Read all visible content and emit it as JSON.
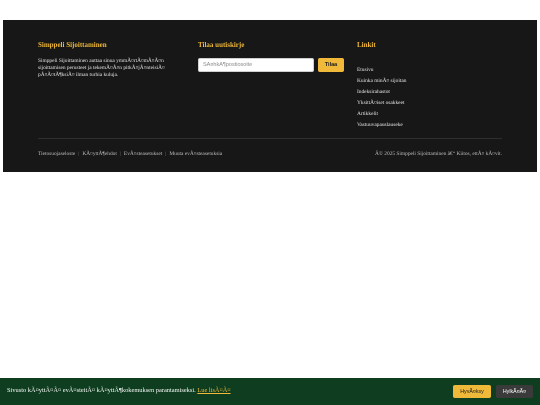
{
  "colors": {
    "footer_background": "#171717",
    "accent": "#f0b93a",
    "cookie_background": "#0e3e1f"
  },
  "about": {
    "title": "Simppeli Sijoittaminen",
    "text": "Simppeli Sijoittaminen auttaa sinua ymmÃ¤rtÃ¤mÃ¤Ã¤n sijoittamisen perusteet ja tekemÃ¤Ã¤n pitkÃ¤jÃ¤nteisiÃ¤ pÃ¤Ã¤tÃ¶ksiÃ¤ ilman turhia kulujа."
  },
  "newsletter": {
    "title": "Tilaa uutiskirje",
    "placeholder": "SÃ¤hkÃ¶postiosoite",
    "subscribe_label": "Tilaa"
  },
  "links": {
    "title": "Linkit",
    "items": [
      {
        "label": "Etusivu"
      },
      {
        "label": "Kuinka minÃ¤ sijoitan"
      },
      {
        "label": "Indeksirahastot"
      },
      {
        "label": "YksittÃ¤iset osakkeet"
      },
      {
        "label": "Artikkelit"
      },
      {
        "label": "Vastuuvapauslauseke"
      }
    ]
  },
  "bottom_bar": {
    "links": [
      {
        "label": "Tietosuojaseloste"
      },
      {
        "label": "KÃ¤yttÃ¶ehdot"
      },
      {
        "label": "EvÃ¤steasetukset"
      },
      {
        "label": "Muuta evÃ¤steasetuksia"
      }
    ],
    "separator": "|",
    "copyright": "Â© 2025 Simppeli Sijoittaminen â€“ Kiitos, ettÃ¤ kÃ¤vit."
  },
  "cookie_banner": {
    "text": "Sivusto kÃ¤yttÃ¤Ã¤ evÃ¤steitÃ¤ kÃ¤yttÃ¶kokemuksen parantamiseksi.",
    "link_label": "Lue lisÃ¤Ã¤",
    "accept_label": "HyvÃ¤ksy",
    "decline_label": "HylkÃ¤Ã¤"
  }
}
